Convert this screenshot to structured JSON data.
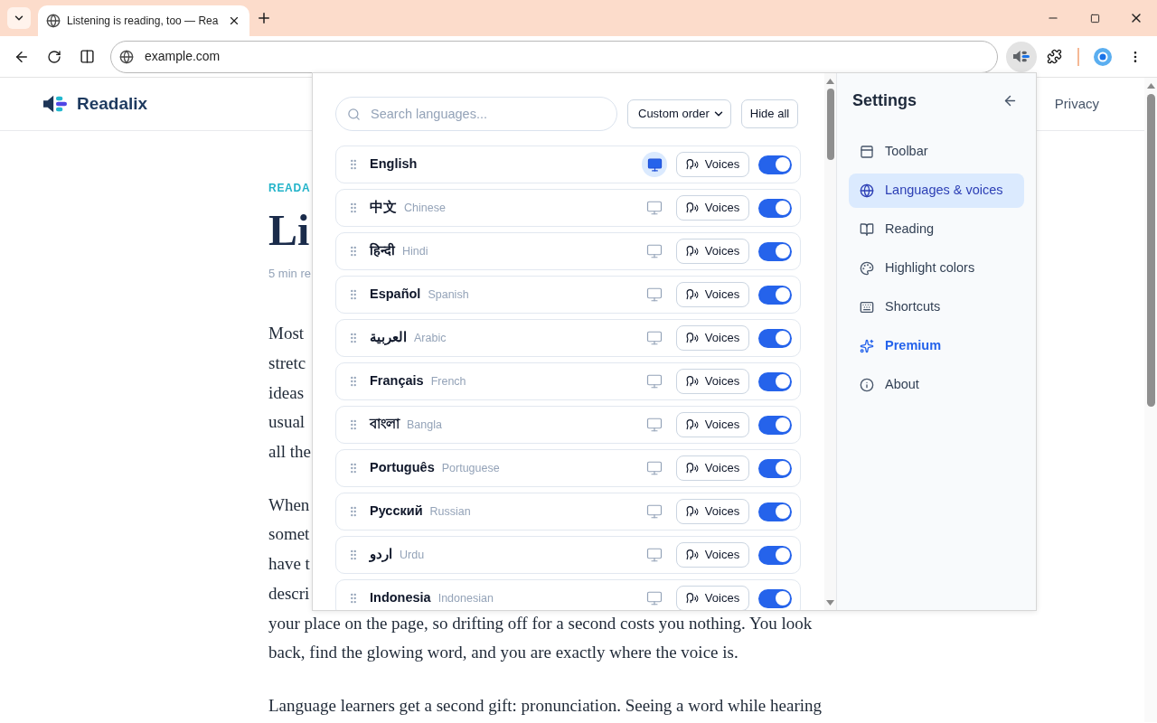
{
  "browser": {
    "tab": {
      "title": "Listening is reading, too — Rea"
    },
    "address": "example.com"
  },
  "site": {
    "logo": "Readalix",
    "nav": [
      "Privacy"
    ]
  },
  "article": {
    "kicker": "READA",
    "title": "Li",
    "meta": "5 min re",
    "paragraphs": [
      [
        "Most",
        "stretc",
        "ideas",
        "usual",
        "all the"
      ],
      [
        "When",
        "somet",
        "have t",
        "descri",
        "your place on the page, so drifting off for a second costs you nothing. You look",
        "back, find the glowing word, and you are exactly where the voice is."
      ],
      [
        "Language learners get a second gift: pronunciation. Seeing a word while hearing"
      ]
    ]
  },
  "popup": {
    "search": {
      "placeholder": "Search languages..."
    },
    "sort": {
      "value": "Custom order"
    },
    "hide_all": "Hide all",
    "languages": [
      {
        "name": "English",
        "system_default": true,
        "voices": "Voices",
        "on": true
      },
      {
        "name": "中文",
        "english_name": "Chinese",
        "system_default": false,
        "voices": "Voices",
        "on": true
      },
      {
        "name": "हिन्दी",
        "english_name": "Hindi",
        "system_default": false,
        "voices": "Voices",
        "on": true
      },
      {
        "name": "Español",
        "english_name": "Spanish",
        "system_default": false,
        "voices": "Voices",
        "on": true
      },
      {
        "name": "العربية",
        "english_name": "Arabic",
        "system_default": false,
        "voices": "Voices",
        "on": true
      },
      {
        "name": "Français",
        "english_name": "French",
        "system_default": false,
        "voices": "Voices",
        "on": true
      },
      {
        "name": "বাংলা",
        "english_name": "Bangla",
        "system_default": false,
        "voices": "Voices",
        "on": true
      },
      {
        "name": "Português",
        "english_name": "Portuguese",
        "system_default": false,
        "voices": "Voices",
        "on": true
      },
      {
        "name": "Русский",
        "english_name": "Russian",
        "system_default": false,
        "voices": "Voices",
        "on": true
      },
      {
        "name": "اردو",
        "english_name": "Urdu",
        "system_default": false,
        "voices": "Voices",
        "on": true
      },
      {
        "name": "Indonesia",
        "english_name": "Indonesian",
        "system_default": false,
        "voices": "Voices",
        "on": true
      }
    ]
  },
  "settings": {
    "title": "Settings",
    "items": [
      {
        "label": "Toolbar",
        "selected": false,
        "kind": "standard"
      },
      {
        "label": "Languages & voices",
        "selected": true,
        "kind": "standard"
      },
      {
        "label": "Reading",
        "selected": false,
        "kind": "standard"
      },
      {
        "label": "Highlight colors",
        "selected": false,
        "kind": "standard"
      },
      {
        "label": "Shortcuts",
        "selected": false,
        "kind": "standard"
      },
      {
        "label": "Premium",
        "selected": false,
        "kind": "premium"
      },
      {
        "label": "About",
        "selected": false,
        "kind": "standard"
      }
    ]
  }
}
